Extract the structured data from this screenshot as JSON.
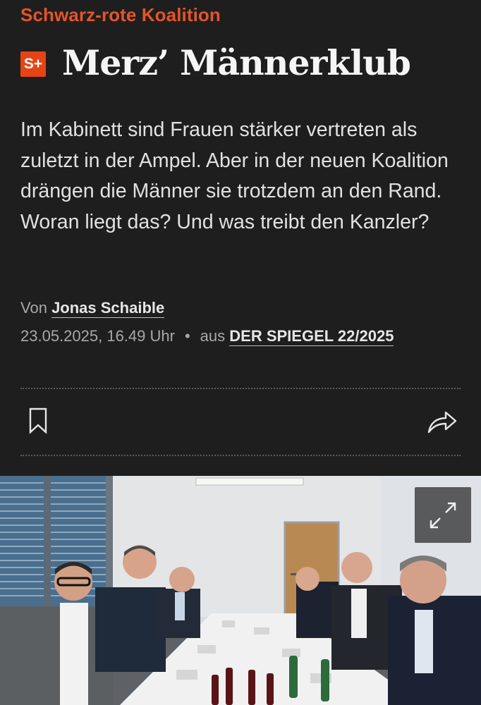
{
  "article": {
    "kicker": "Schwarz-rote Koalition",
    "badge": "S+",
    "headline": "Merz’ Männerklub",
    "lead": "Im Kabinett sind Frauen stärker vertreten als zuletzt in der Ampel. Aber in der neuen Koalition drängen die Männer sie trotzdem an den Rand. Woran liegt das? Und was treibt den Kanzler?",
    "byline_prefix": "Von",
    "author": "Jonas Schaible",
    "date": "23.05.2025, 16.49 Uhr",
    "separator": "•",
    "source_prefix": "aus",
    "source": "DER SPIEGEL 22/2025"
  },
  "actions": {
    "bookmark_icon": "bookmark-icon",
    "share_icon": "share-icon",
    "expand_icon": "expand-icon"
  },
  "colors": {
    "background": "#1e1e1e",
    "kicker": "#e4542b",
    "badge": "#e64415"
  }
}
